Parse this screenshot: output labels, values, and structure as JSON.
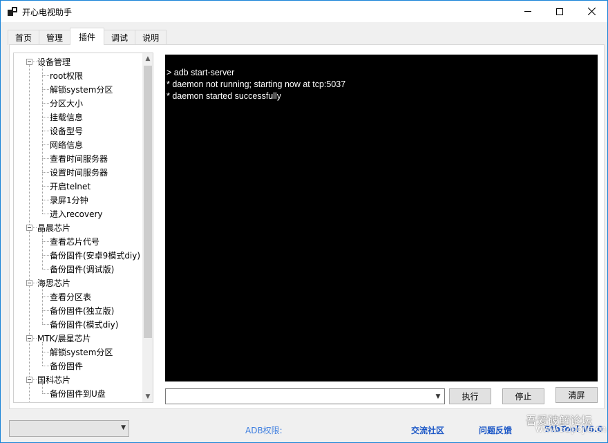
{
  "window": {
    "title": "开心电视助手"
  },
  "tabs": [
    {
      "label": "首页"
    },
    {
      "label": "管理"
    },
    {
      "label": "插件"
    },
    {
      "label": "调试"
    },
    {
      "label": "说明"
    }
  ],
  "tree": {
    "groups": [
      {
        "label": "设备管理",
        "items": [
          "root权限",
          "解锁system分区",
          "分区大小",
          "挂载信息",
          "设备型号",
          "网络信息",
          "查看时间服务器",
          "设置时间服务器",
          "开启telnet",
          "录屏1分钟",
          "进入recovery"
        ]
      },
      {
        "label": "晶晨芯片",
        "items": [
          "查看芯片代号",
          "备份固件(安卓9模式diy)",
          "备份固件(调试版)"
        ]
      },
      {
        "label": "海思芯片",
        "items": [
          "查看分区表",
          "备份固件(独立版)",
          "备份固件(模式diy)"
        ]
      },
      {
        "label": "MTK/晨星芯片",
        "items": [
          "解锁system分区",
          "备份固件"
        ]
      },
      {
        "label": "国科芯片",
        "items": [
          "备份固件到U盘"
        ]
      }
    ]
  },
  "console": {
    "lines": [
      "> adb start-server",
      "* daemon not running; starting now at tcp:5037",
      "* daemon started successfully"
    ]
  },
  "command": {
    "value": ""
  },
  "buttons": {
    "execute": "执行",
    "stop": "停止",
    "clear": "清屏"
  },
  "status": {
    "device_select": "",
    "adb_permission": "ADB权限:",
    "community": "交流社区",
    "feedback": "问题反馈",
    "version": "StbTool V6.0"
  },
  "watermark": {
    "text": "吾爱破解论坛",
    "sub": "www.52pojie.cn"
  }
}
